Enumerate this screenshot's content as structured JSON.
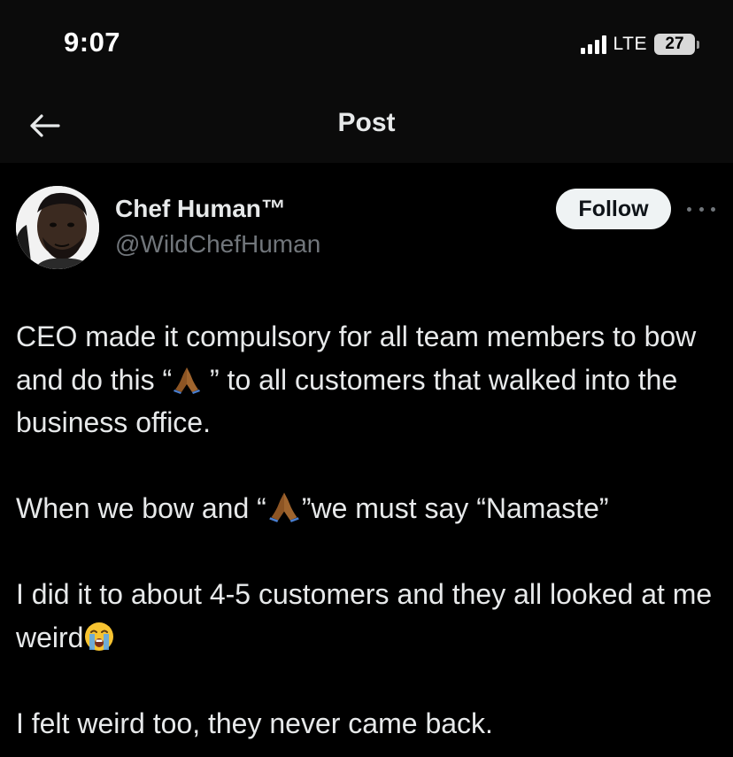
{
  "status_bar": {
    "time": "9:07",
    "network": "LTE",
    "battery": "27"
  },
  "nav": {
    "back_icon": "arrow-left-icon",
    "title": "Post"
  },
  "post": {
    "author": {
      "display_name": "Chef Human™",
      "handle": "@WildChefHuman"
    },
    "follow_label": "Follow",
    "more_icon": "more-horizontal-icon",
    "text": {
      "p1_before": "CEO made it compulsory for all team members to bow and do this “",
      "p1_after": " ” to all customers that walked into the business office.",
      "p2_before": "When we bow and “",
      "p2_after": "”we must say “Namaste”",
      "p3": "I did it to about 4-5 customers and they all looked at me weird",
      "p4": "I felt weird too, they never came back."
    },
    "emojis": {
      "praying_hands": "folded-hands-icon",
      "crying": "loudly-crying-face-icon"
    }
  },
  "colors": {
    "background": "#000000",
    "text": "#e7e9ea",
    "secondary_text": "#71767b",
    "follow_bg": "#eff3f4"
  }
}
